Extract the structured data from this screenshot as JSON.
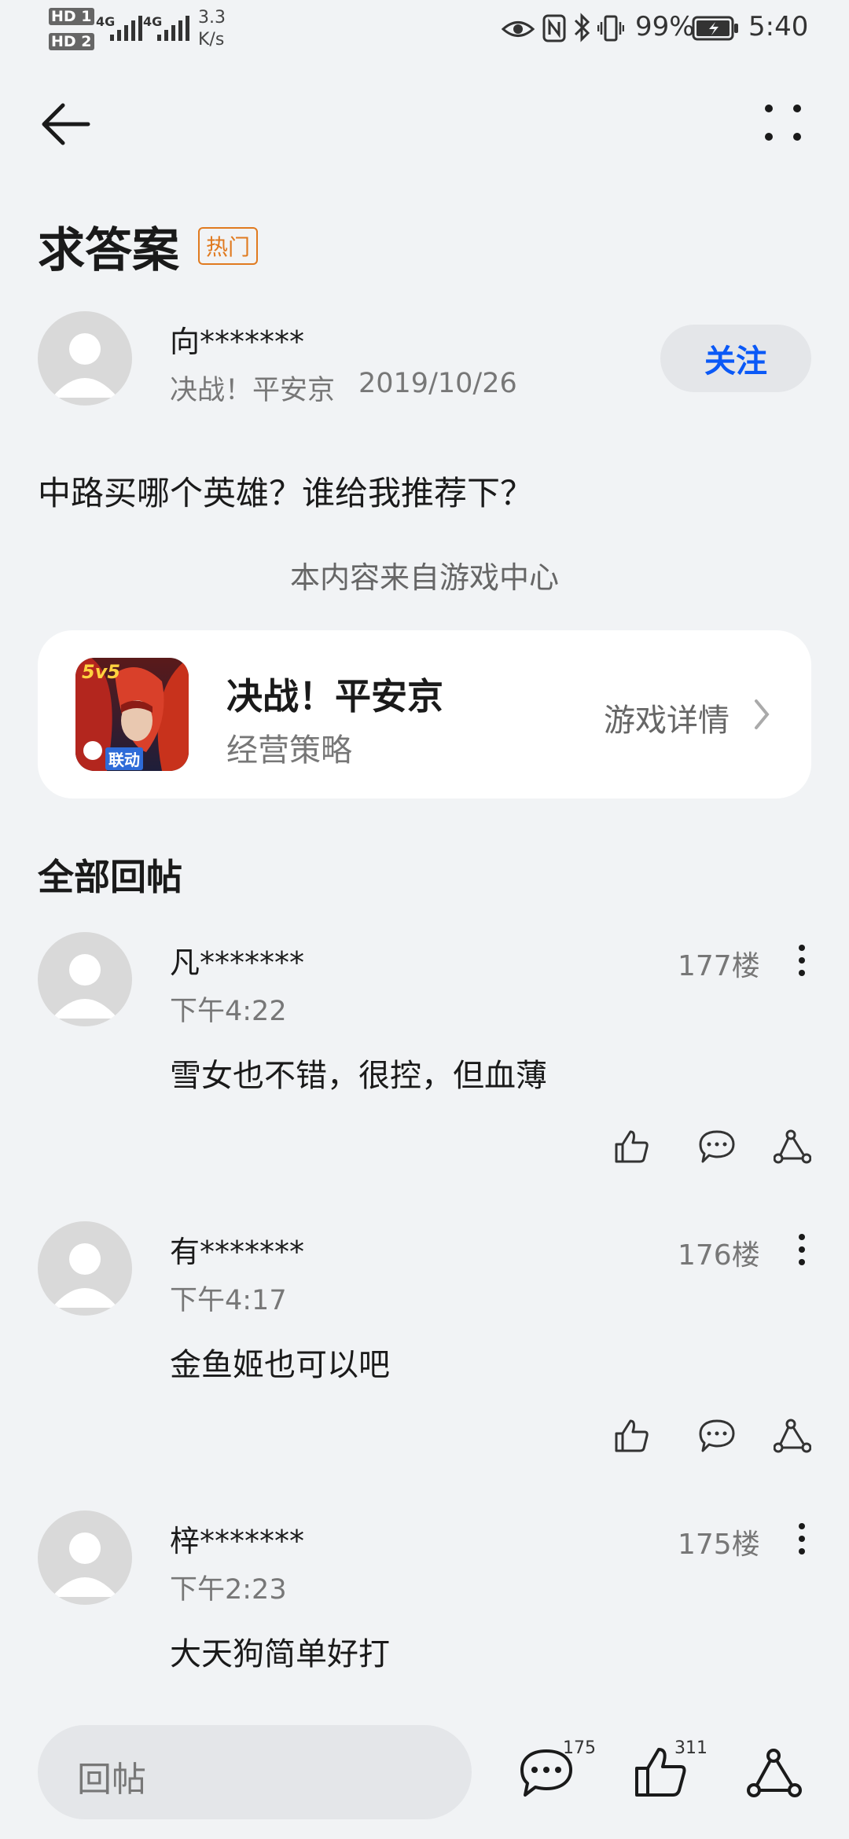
{
  "status_bar": {
    "sim1": "HD 1",
    "sim2": "HD 2",
    "net1": "4G",
    "net2": "4G",
    "speed_value": "3.3",
    "speed_unit": "K/s",
    "battery": "99%",
    "time": "5:40"
  },
  "header": {
    "title": "求答案",
    "badge": "热门"
  },
  "post": {
    "author": "向*******",
    "game": "决战！平安京",
    "date": "2019/10/26",
    "follow_label": "关注",
    "question": "中路买哪个英雄？谁给我推荐下？",
    "source_note": "本内容来自游戏中心"
  },
  "game_card": {
    "icon_badge": "5v5",
    "icon_tag": "联动",
    "name": "决战！平安京",
    "category": "经营策略",
    "detail_label": "游戏详情"
  },
  "replies_section": {
    "title": "全部回帖",
    "items": [
      {
        "user": "凡*******",
        "time": "下午4:22",
        "floor": "177楼",
        "text": "雪女也不错，很控，但血薄"
      },
      {
        "user": "有*******",
        "time": "下午4:17",
        "floor": "176楼",
        "text": "金鱼姬也可以吧"
      },
      {
        "user": "梓*******",
        "time": "下午2:23",
        "floor": "175楼",
        "text": "大天狗简单好打"
      }
    ]
  },
  "bottom_bar": {
    "reply_placeholder": "回帖",
    "comment_count": "175",
    "like_count": "311"
  },
  "colors": {
    "accent": "#0a59f7",
    "hot_badge": "#e07a1f",
    "background": "#f1f3f5"
  }
}
